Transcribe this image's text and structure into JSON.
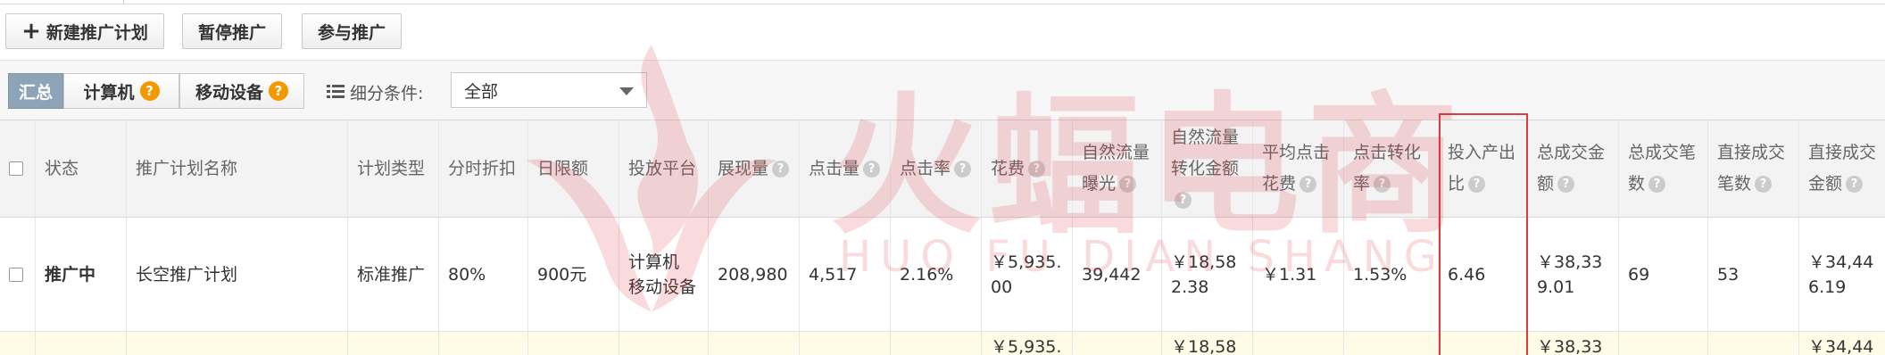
{
  "toolbar": {
    "new_plan": "新建推广计划",
    "pause": "暂停推广",
    "join": "参与推广"
  },
  "filters": {
    "tabs": [
      {
        "label": "汇总"
      },
      {
        "label": "计算机",
        "help": "?"
      },
      {
        "label": "移动设备",
        "help": "?"
      }
    ],
    "condition_label": "细分条件:",
    "condition_value": "全部"
  },
  "table": {
    "headers": {
      "status": "状态",
      "name": "推广计划名称",
      "type": "计划类型",
      "time_discount": "分时折扣",
      "daily_limit": "日限额",
      "platform": "投放平台",
      "impressions": "展现量",
      "clicks": "点击量",
      "ctr": "点击率",
      "cost": "花费",
      "natural_exposure": "自然流量曝光",
      "natural_conversion": "自然流量转化金额",
      "avg_cpc": "平均点击花费",
      "cvr": "点击转化率",
      "roi": "投入产出比",
      "total_amount": "总成交金额",
      "total_orders": "总成交笔数",
      "direct_orders": "直接成交笔数",
      "direct_amount": "直接成交金额"
    },
    "row": {
      "status": "推广中",
      "name": "长空推广计划",
      "type": "标准推广",
      "time_discount": "80%",
      "daily_limit": "900元",
      "platform_1": "计算机",
      "platform_2": "移动设备",
      "impressions": "208,980",
      "clicks": "4,517",
      "ctr": "2.16%",
      "cost": "￥5,935.00",
      "natural_exposure": "39,442",
      "natural_conversion": "￥18,582.38",
      "avg_cpc": "￥1.31",
      "cvr": "1.53%",
      "roi": "6.46",
      "total_amount": "￥38,339.01",
      "total_orders": "69",
      "direct_orders": "53",
      "direct_amount": "￥34,446.19"
    },
    "partial_row": {
      "cost": "￥5,935.",
      "natural_conversion": "￥18,58",
      "total_amount": "￥38,33",
      "direct_amount": "￥34,44"
    }
  },
  "watermark": {
    "title": "火蝠电商",
    "subtitle": "HUO FU DIAN SHANG"
  },
  "colors": {
    "accent_blue": "#3366cc",
    "status_green": "#33a333",
    "help_orange": "#f39800",
    "highlight_red": "#e03a3a"
  }
}
